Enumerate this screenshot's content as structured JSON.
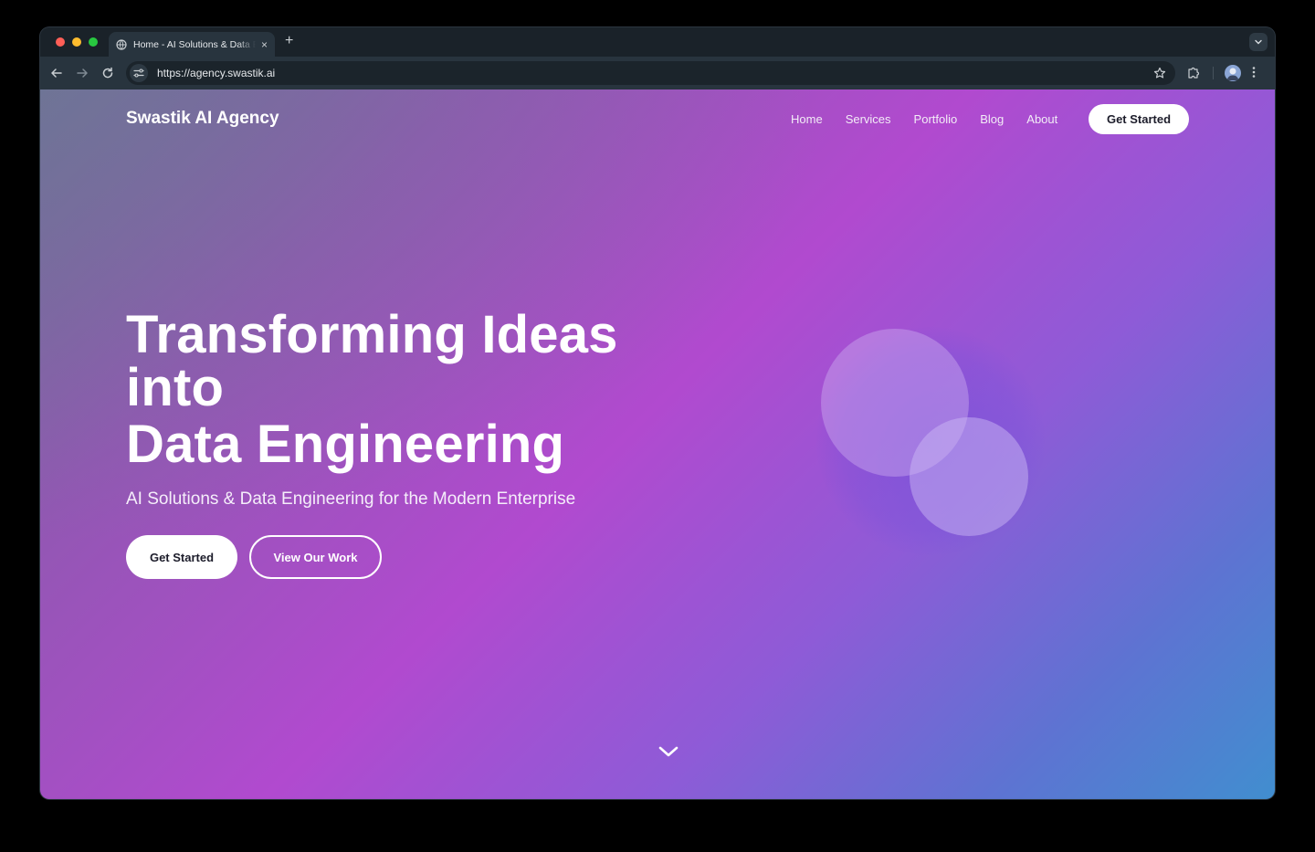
{
  "browser": {
    "tab_title": "Home - AI Solutions & Data Engineering",
    "tab_close": "×",
    "new_tab": "+",
    "url": "https://agency.swastik.ai"
  },
  "site": {
    "brand": "Swastik AI Agency",
    "nav": [
      {
        "label": "Home"
      },
      {
        "label": "Services"
      },
      {
        "label": "Portfolio"
      },
      {
        "label": "Blog"
      },
      {
        "label": "About"
      }
    ],
    "nav_cta": "Get Started"
  },
  "hero": {
    "title_line1": "Transforming Ideas",
    "title_line2": "into",
    "title_line3": "Data Engineering",
    "subtitle": "AI Solutions & Data Engineering for the Modern Enterprise",
    "primary_button": "Get Started",
    "secondary_button": "View Our Work"
  },
  "icons": {
    "back": "arrow-left-icon",
    "forward": "arrow-right-icon",
    "reload": "reload-icon",
    "site_info": "tune-icon",
    "bookmark": "star-icon",
    "extensions": "puzzle-icon",
    "menu": "kebab-icon",
    "scroll": "chevron-down-icon"
  },
  "colors": {
    "gradient_start": "#6f6f96",
    "gradient_mid": "#b14acf",
    "gradient_end": "#418ecf",
    "button_bg": "#ffffff"
  }
}
